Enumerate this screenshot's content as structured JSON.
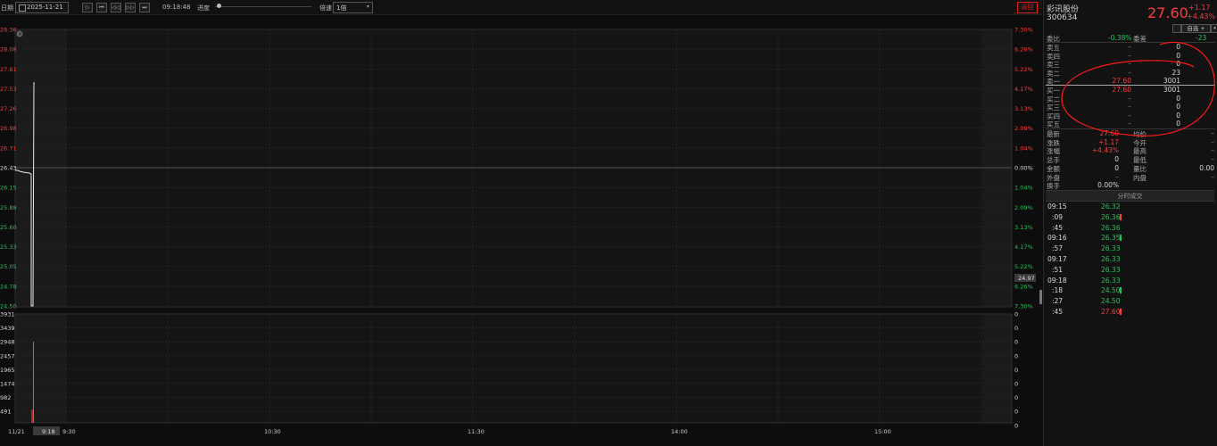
{
  "toolbar": {
    "date_label": "日期",
    "date_value": "2025-11-21",
    "time": "09:18:48",
    "progress_label": "进度",
    "progress_fraction": 0.02,
    "speed_label": "倍速",
    "speed_value": "1倍",
    "return_label": "返回"
  },
  "price_axis": {
    "left_labels": [
      "28.36",
      "28.08",
      "27.81",
      "27.53",
      "27.26",
      "26.98",
      "26.71",
      "26.43",
      "26.15",
      "25.88",
      "25.60",
      "25.33",
      "25.05",
      "24.78",
      "24.50"
    ],
    "right_labels": [
      "7.30%",
      "6.26%",
      "5.22%",
      "4.17%",
      "3.13%",
      "2.09%",
      "1.04%",
      "0.00%",
      "1.04%",
      "2.09%",
      "3.13%",
      "4.17%",
      "5.22%",
      "6.26%",
      "7.30%"
    ],
    "cursor_value": "24.97"
  },
  "volume_axis": {
    "left_labels": [
      "3931",
      "3439",
      "2948",
      "2457",
      "1965",
      "1474",
      "982",
      "491"
    ],
    "right_labels": [
      "0",
      "0",
      "0",
      "0",
      "0",
      "0",
      "0",
      "0",
      "0"
    ]
  },
  "time_axis": {
    "date": "11/21",
    "cursor_time": "9:18",
    "labels": [
      "9:30",
      "10:30",
      "11:30",
      "14:00",
      "15:00"
    ]
  },
  "stock": {
    "name": "彩讯股份",
    "code": "300634",
    "price": "27.60",
    "change": "+1.17",
    "change_pct": "+4.43%",
    "favorite_label": "自选 +",
    "favorite_dropdown": "▾"
  },
  "order_book": {
    "ratio_label": "委比",
    "ratio_value": "-0.38%",
    "diff_label": "委差",
    "diff_value": "-23",
    "asks": [
      {
        "label": "卖五",
        "price": "–",
        "volume": "0"
      },
      {
        "label": "卖四",
        "price": "–",
        "volume": "0"
      },
      {
        "label": "卖三",
        "price": "–",
        "volume": "0"
      },
      {
        "label": "卖二",
        "price": "–",
        "volume": "23"
      },
      {
        "label": "卖一",
        "price": "27.60",
        "volume": "3001"
      }
    ],
    "bids": [
      {
        "label": "买一",
        "price": "27.60",
        "volume": "3001"
      },
      {
        "label": "买二",
        "price": "–",
        "volume": "0"
      },
      {
        "label": "买三",
        "price": "–",
        "volume": "0"
      },
      {
        "label": "买四",
        "price": "–",
        "volume": "0"
      },
      {
        "label": "买五",
        "price": "–",
        "volume": "0"
      }
    ]
  },
  "stats": [
    {
      "l1": "最新",
      "v1": "27.60",
      "l2": "均价",
      "v2": "–"
    },
    {
      "l1": "涨跌",
      "v1": "+1.17",
      "l2": "今开",
      "v2": "–"
    },
    {
      "l1": "涨幅",
      "v1": "+4.43%",
      "l2": "最高",
      "v2": "–"
    },
    {
      "l1": "总手",
      "v1": "0",
      "l2": "最低",
      "v2": "–"
    },
    {
      "l1": "金额",
      "v1": "0",
      "l2": "量比",
      "v2": "0.00"
    },
    {
      "l1": "外盘",
      "v1": "–",
      "l2": "内盘",
      "v2": "–"
    },
    {
      "l1": "换手",
      "v1": "0.00%",
      "l2": "",
      "v2": ""
    }
  ],
  "trades_title": "分时成交",
  "trades": [
    {
      "time": "09:15",
      "price": "26.32",
      "color": "green",
      "arrow": ""
    },
    {
      "time": ":09",
      "price": "26.36",
      "color": "green",
      "arrow": "red"
    },
    {
      "time": ":45",
      "price": "26.36",
      "color": "green",
      "arrow": ""
    },
    {
      "time": "09:16",
      "price": "26.35",
      "color": "green",
      "arrow": "green"
    },
    {
      "time": ":57",
      "price": "26.33",
      "color": "green",
      "arrow": ""
    },
    {
      "time": "09:17",
      "price": "26.33",
      "color": "green",
      "arrow": ""
    },
    {
      "time": ":51",
      "price": "26.33",
      "color": "green",
      "arrow": ""
    },
    {
      "time": "09:18",
      "price": "26.33",
      "color": "green",
      "arrow": ""
    },
    {
      "time": ":18",
      "price": "24.50",
      "color": "green",
      "arrow": "green"
    },
    {
      "time": ":27",
      "price": "24.50",
      "color": "green",
      "arrow": ""
    },
    {
      "time": ":45",
      "price": "27.60",
      "color": "red",
      "arrow": "red"
    }
  ],
  "colors": {
    "up": "#ff3b3b",
    "down": "#21c45a",
    "annotation": "#ff1a1a"
  }
}
